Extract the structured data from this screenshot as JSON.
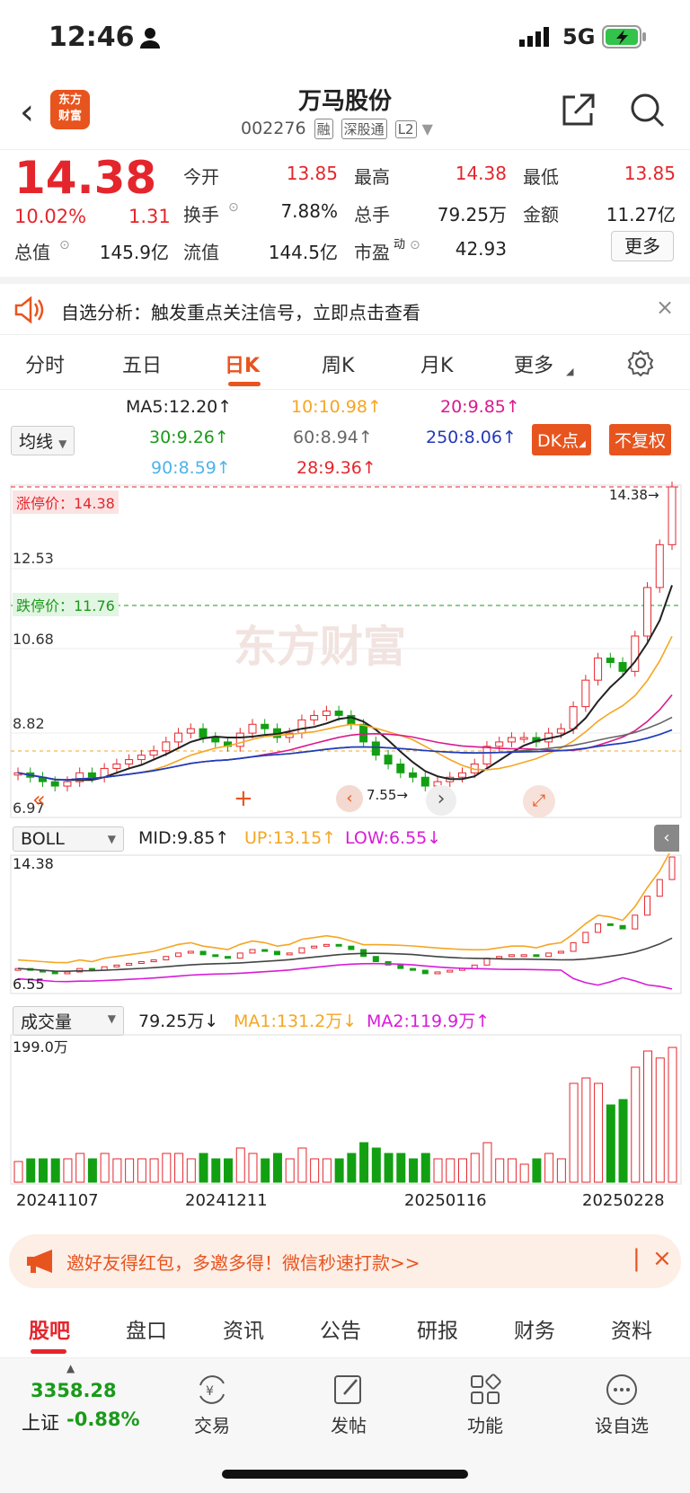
{
  "status": {
    "time": "12:46",
    "network": "5G"
  },
  "header": {
    "logo_line1": "东方",
    "logo_line2": "财富",
    "stock_name": "万马股份",
    "stock_code": "002276",
    "tags": [
      "融",
      "深股通",
      "L2"
    ]
  },
  "quote": {
    "price": "14.38",
    "change_pct": "10.02%",
    "change": "1.31",
    "fields": [
      {
        "label": "今开",
        "value": "13.85"
      },
      {
        "label": "最高",
        "value": "14.38"
      },
      {
        "label": "最低",
        "value": "13.85"
      },
      {
        "label": "换手",
        "value": "7.88%"
      },
      {
        "label": "总手",
        "value": "79.25万"
      },
      {
        "label": "金额",
        "value": "11.27亿"
      },
      {
        "label": "总值",
        "value": "145.9亿"
      },
      {
        "label": "流值",
        "value": "144.5亿"
      },
      {
        "label": "市盈",
        "value": "42.93"
      }
    ],
    "pe_superscript": "动",
    "more_label": "更多"
  },
  "notice": {
    "text": "自选分析：触发重点关注信号，立即点击查看"
  },
  "tabs": [
    "分时",
    "五日",
    "日K",
    "周K",
    "月K",
    "更多"
  ],
  "active_tab": "日K",
  "ma_legend": {
    "selector": "均线",
    "items": [
      {
        "text": "MA5:12.20↑",
        "color": "#222222"
      },
      {
        "text": "10:10.98↑",
        "color": "#f5a623"
      },
      {
        "text": "20:9.85↑",
        "color": "#d81b8c"
      },
      {
        "text": "30:9.26↑",
        "color": "#1a9a1a"
      },
      {
        "text": "60:8.94↑",
        "color": "#666666"
      },
      {
        "text": "250:8.06↑",
        "color": "#2338b8"
      },
      {
        "text": "90:8.59↑",
        "color": "#4fb3e8"
      },
      {
        "text": "28:9.36↑",
        "color": "#e4262c"
      }
    ],
    "dk_button": "DK点",
    "restore_button": "不复权"
  },
  "kline": {
    "limit_up_label": "涨停价：14.38",
    "limit_down_label": "跌停价：11.76",
    "axis_labels": [
      "12.53",
      "10.68",
      "8.82",
      "6.97"
    ],
    "last_price_label": "14.38",
    "low_label": "7.55",
    "watermark": "东方财富"
  },
  "boll": {
    "selector": "BOLL",
    "mid": "MID:9.85↑",
    "up": "UP:13.15↑",
    "low": "LOW:6.55↓",
    "top_label": "14.38",
    "bottom_label": "6.55"
  },
  "volume": {
    "selector": "成交量",
    "value": "79.25万↓",
    "ma1": "MA1:131.2万↓",
    "ma2": "MA2:119.9万↑",
    "top_label": "199.0万",
    "dates": [
      "20241107",
      "20241211",
      "20250116",
      "20250228"
    ]
  },
  "chart_data": {
    "type": "bar",
    "title": "",
    "x": [
      "20241107",
      "20241211",
      "20250116",
      "20250228"
    ],
    "closes": [
      7.9,
      7.8,
      7.7,
      7.6,
      7.7,
      7.9,
      7.8,
      8.0,
      8.1,
      8.2,
      8.3,
      8.4,
      8.6,
      8.8,
      8.9,
      8.7,
      8.6,
      8.5,
      8.8,
      9.0,
      8.9,
      8.7,
      8.8,
      9.1,
      9.2,
      9.3,
      9.2,
      9.0,
      8.6,
      8.3,
      8.1,
      7.9,
      7.8,
      7.6,
      7.7,
      7.8,
      7.9,
      8.1,
      8.5,
      8.6,
      8.7,
      8.7,
      8.6,
      8.8,
      8.9,
      9.4,
      10.0,
      10.5,
      10.4,
      10.2,
      11.0,
      12.1,
      13.07,
      14.38
    ],
    "ylim": [
      6.97,
      14.38
    ]
  },
  "banner": {
    "text": "邀好友得红包，多邀多得！微信秒速打款>>"
  },
  "bottom_tabs": [
    "股吧",
    "盘口",
    "资讯",
    "公告",
    "研报",
    "财务",
    "资料"
  ],
  "dock": {
    "index_value": "3358.28",
    "index_name": "上证",
    "index_change": "-0.88%",
    "items": [
      "交易",
      "发帖",
      "功能",
      "设自选"
    ]
  }
}
